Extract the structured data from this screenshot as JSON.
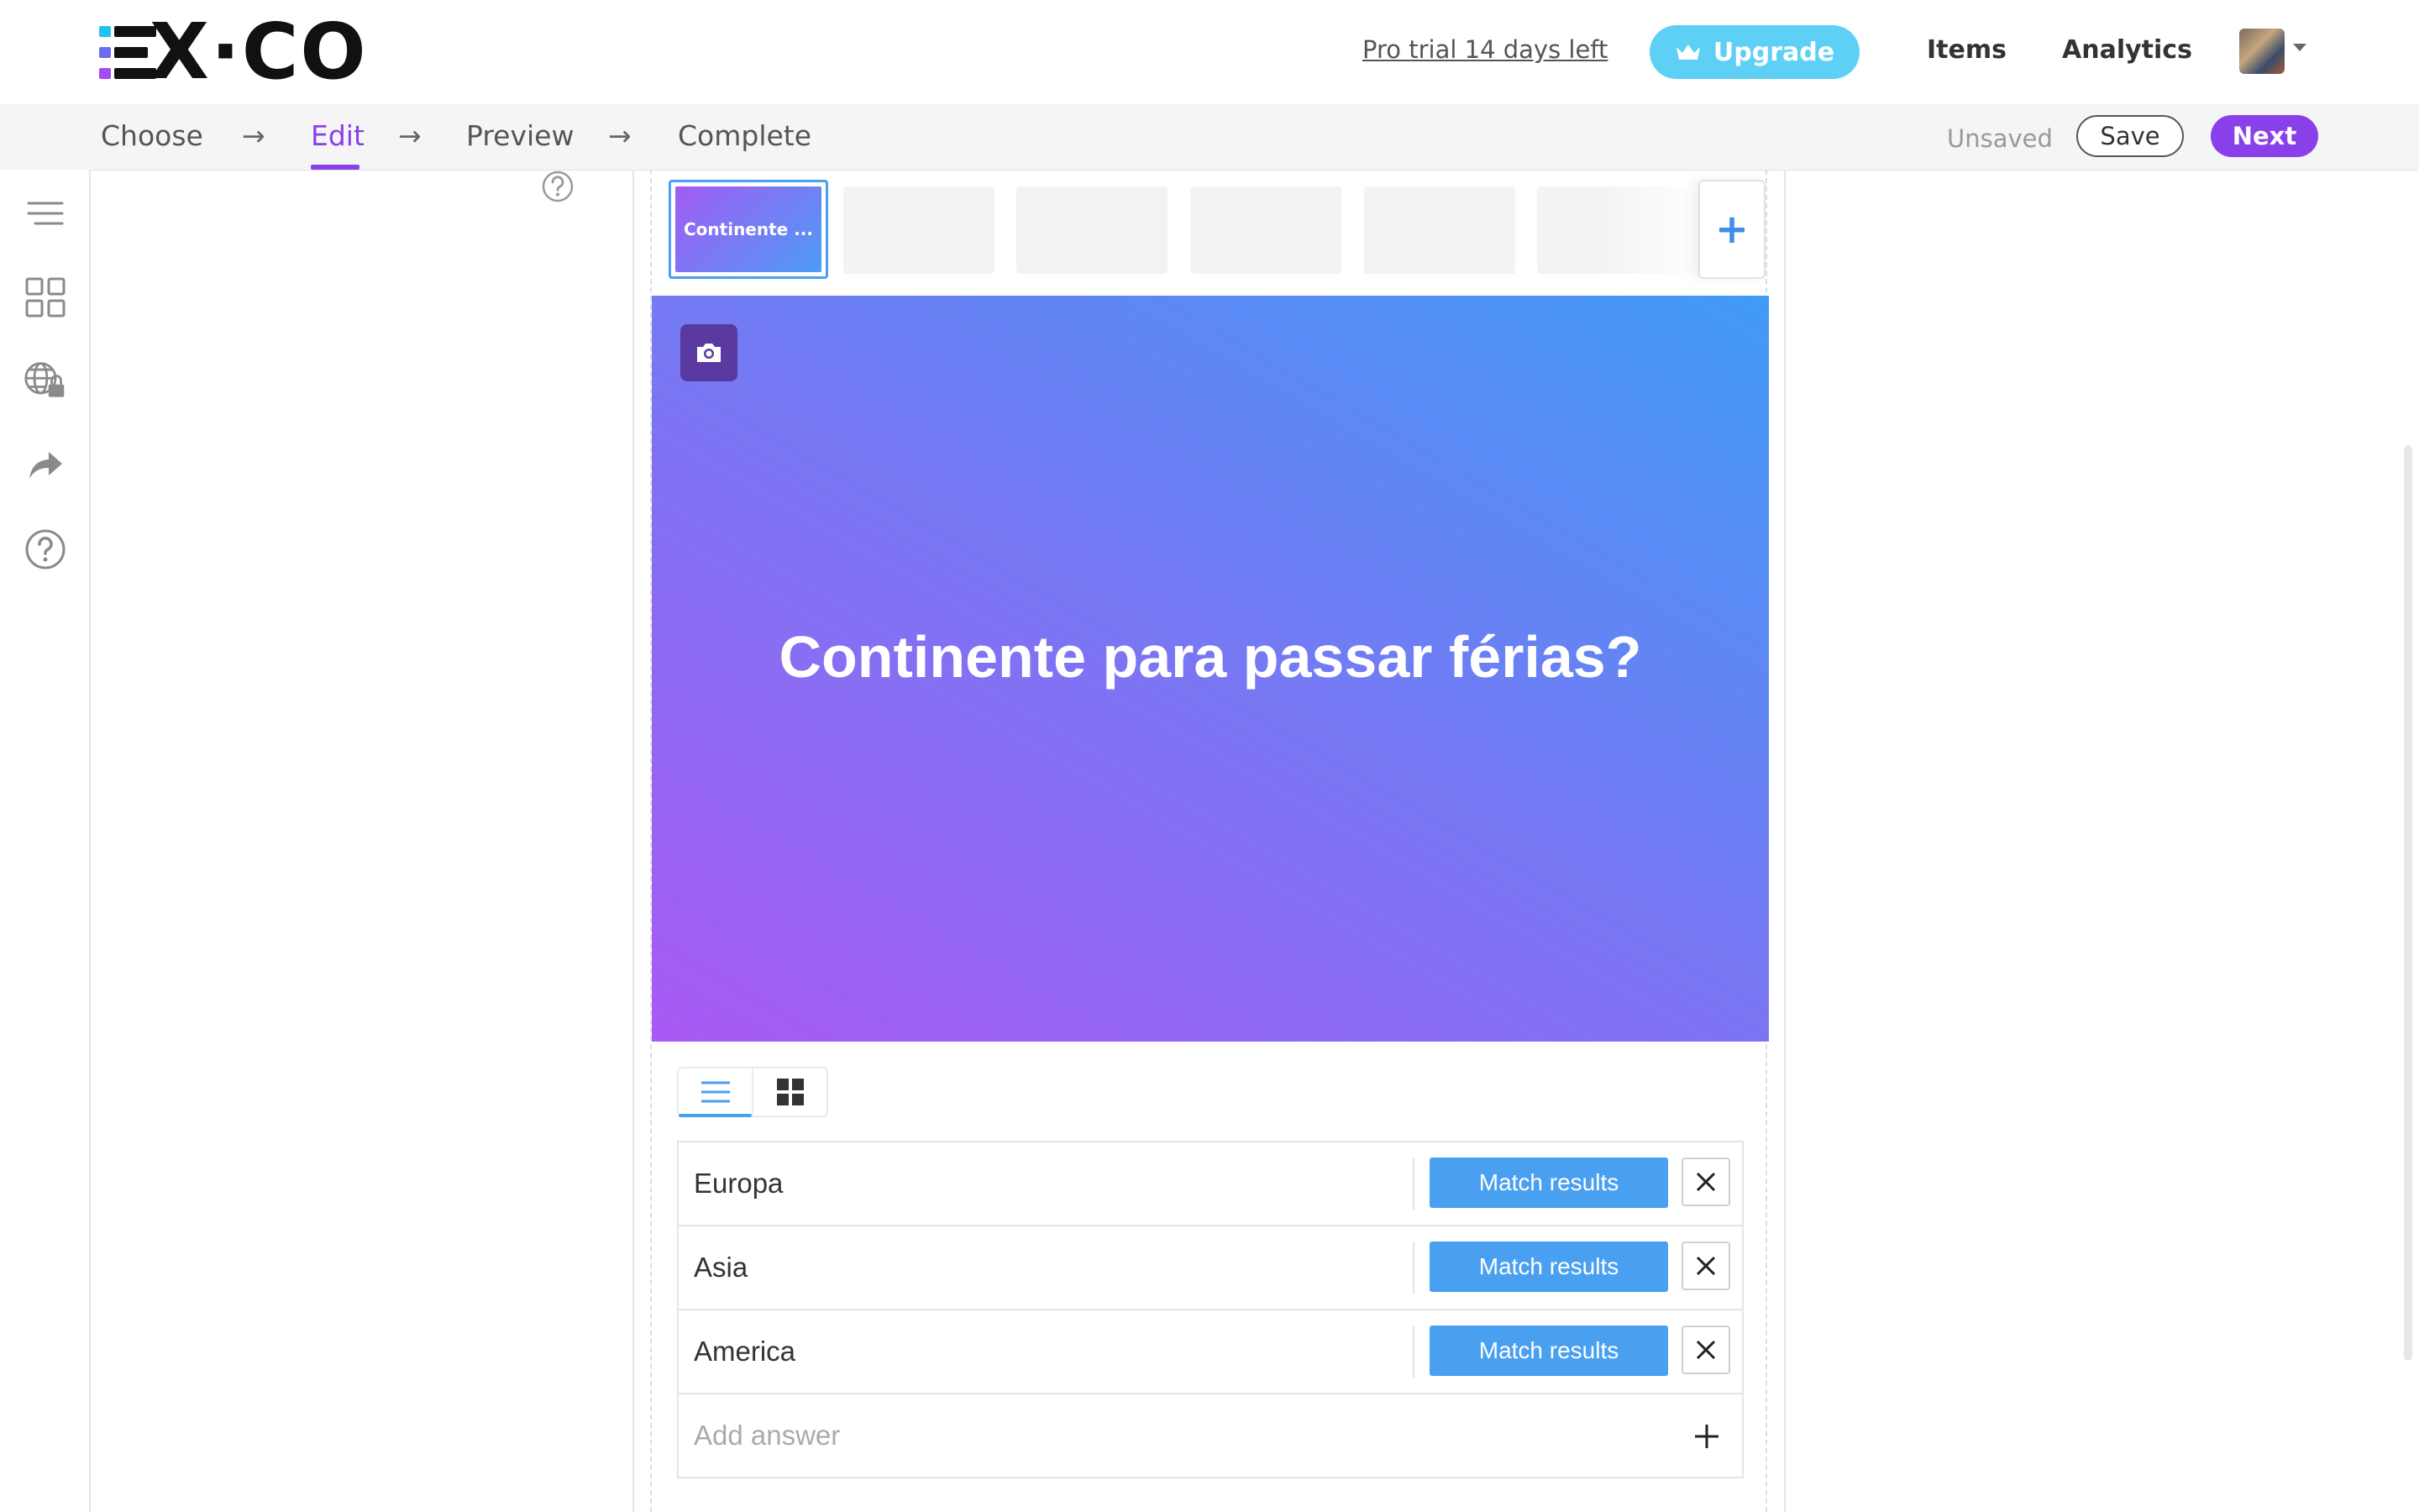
{
  "header": {
    "logo": "EX·CO",
    "trial_text": "Pro trial 14 days left",
    "upgrade_label": "Upgrade",
    "nav": [
      "Items",
      "Analytics"
    ]
  },
  "steps": {
    "items": [
      "Choose",
      "Edit",
      "Preview",
      "Complete"
    ],
    "active": "Edit",
    "separator": "→",
    "status": "Unsaved",
    "save_label": "Save",
    "next_label": "Next"
  },
  "sidebar": {
    "icons": [
      "menu-icon",
      "grid-icon",
      "globe-lock-icon",
      "share-icon",
      "help-icon"
    ]
  },
  "slides": {
    "thumbnails": [
      {
        "label": "Continente ...",
        "selected": true
      },
      {
        "label": ""
      },
      {
        "label": ""
      },
      {
        "label": ""
      },
      {
        "label": ""
      },
      {
        "label": ""
      }
    ],
    "add_icon": "plus-icon"
  },
  "question": {
    "title": "Continente para passar férias?",
    "gradient": [
      "#a95af4",
      "#409af6"
    ]
  },
  "answers": {
    "items": [
      {
        "text": "Europa",
        "action": "Match results"
      },
      {
        "text": "Asia",
        "action": "Match results"
      },
      {
        "text": "America",
        "action": "Match results"
      }
    ],
    "add_placeholder": "Add answer"
  },
  "colors": {
    "accent": "#8a40e8",
    "primary_button": "#4aa0f0",
    "upgrade": "#5fd0f5"
  }
}
